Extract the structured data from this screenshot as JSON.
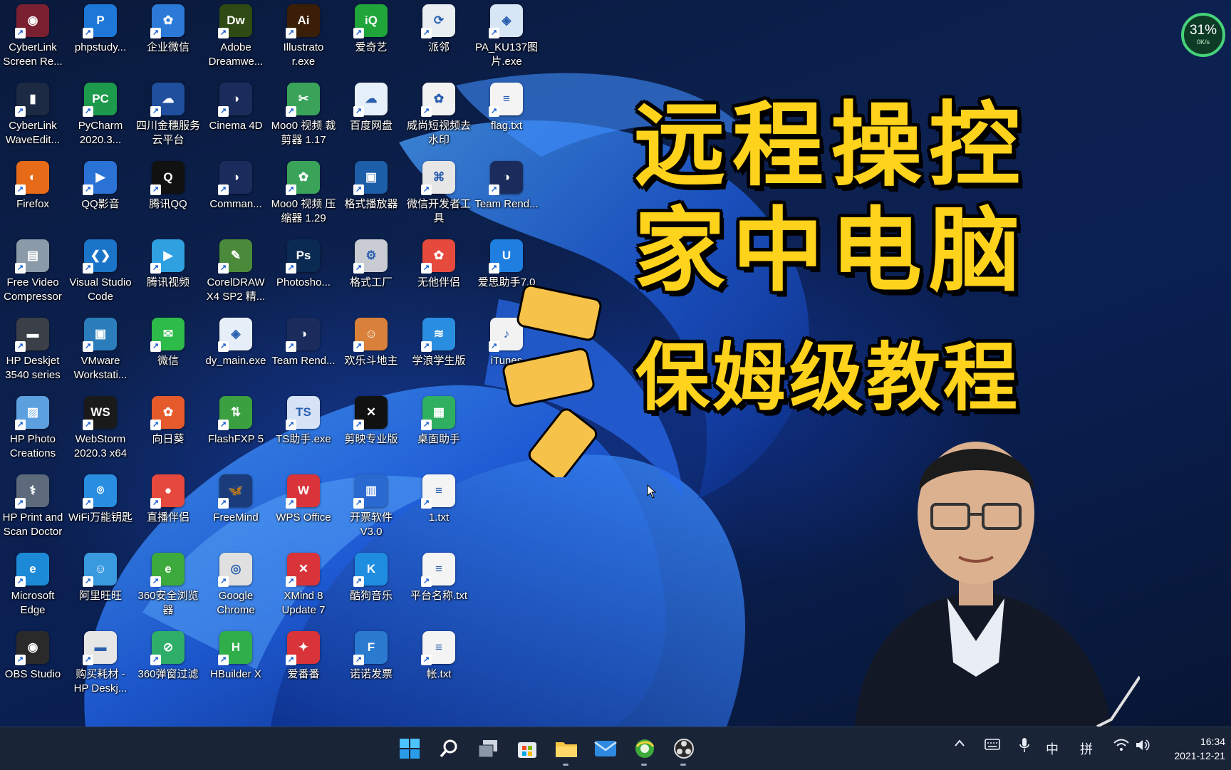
{
  "desktop": {
    "icons": [
      {
        "label": "CyberLink Screen Re...",
        "icon": "cyberlink-screen-recorder-icon",
        "color": "#7a2030",
        "glyph": "◉"
      },
      {
        "label": "phpstudy...",
        "icon": "phpstudy-icon",
        "color": "#1e78d8",
        "glyph": "P"
      },
      {
        "label": "企业微信",
        "icon": "wecom-icon",
        "color": "#2b7ad8",
        "glyph": "✿"
      },
      {
        "label": "Adobe Dreamwe...",
        "icon": "dreamweaver-icon",
        "color": "#2f4a12",
        "glyph": "Dw"
      },
      {
        "label": "Illustrato r.exe",
        "icon": "illustrator-icon",
        "color": "#3a1e06",
        "glyph": "Ai"
      },
      {
        "label": "爱奇艺",
        "icon": "iqiyi-icon",
        "color": "#1fa53a",
        "glyph": "iQ"
      },
      {
        "label": "派邻",
        "icon": "pailin-icon",
        "color": "#e8eef2",
        "glyph": "⟳"
      },
      {
        "label": "PA_KU137图 片.exe",
        "icon": "image-exe-icon",
        "color": "#d6e6f5",
        "glyph": "◈"
      },
      {
        "label": "CyberLink WaveEdit...",
        "icon": "cyberlink-waveeditor-icon",
        "color": "#1c2a44",
        "glyph": "▮"
      },
      {
        "label": "PyCharm 2020.3...",
        "icon": "pycharm-icon",
        "color": "#1d9a4b",
        "glyph": "PC"
      },
      {
        "label": "四川金穗服务 云平台",
        "icon": "sichuan-jinsui-icon",
        "color": "#1f4f9d",
        "glyph": "☁"
      },
      {
        "label": "Cinema 4D",
        "icon": "cinema4d-icon",
        "color": "#1b2c5c",
        "glyph": "◑"
      },
      {
        "label": "Moo0 视频 裁剪器 1.17",
        "icon": "moo0-video-cutter-icon",
        "color": "#3aa35a",
        "glyph": "✂"
      },
      {
        "label": "百度网盘",
        "icon": "baidu-netdisk-icon",
        "color": "#e6f0fb",
        "glyph": "☁"
      },
      {
        "label": "威尚短视频去 水印",
        "icon": "watermark-remover-icon",
        "color": "#f2f2f2",
        "glyph": "✿"
      },
      {
        "label": "flag.txt",
        "icon": "text-file-icon",
        "color": "#f4f4f4",
        "glyph": "≡"
      },
      {
        "label": "Firefox",
        "icon": "firefox-icon",
        "color": "#e66a17",
        "glyph": "◐"
      },
      {
        "label": "QQ影音",
        "icon": "qq-player-icon",
        "color": "#2a72d6",
        "glyph": "▶"
      },
      {
        "label": "腾讯QQ",
        "icon": "tencent-qq-icon",
        "color": "#111111",
        "glyph": "Q"
      },
      {
        "label": "Comman...",
        "icon": "command-app-icon",
        "color": "#1b2c5c",
        "glyph": "◑"
      },
      {
        "label": "Moo0 视频 压缩器 1.29",
        "icon": "moo0-video-compressor-icon",
        "color": "#3aa35a",
        "glyph": "✿"
      },
      {
        "label": "格式播放器",
        "icon": "format-player-icon",
        "color": "#1d5ea8",
        "glyph": "▣"
      },
      {
        "label": "微信开发者工 具",
        "icon": "wechat-devtools-icon",
        "color": "#e6e6e6",
        "glyph": "⌘"
      },
      {
        "label": "Team Rend...",
        "icon": "team-render-icon",
        "color": "#1b2c5c",
        "glyph": "◑"
      },
      {
        "label": "Free Video Compressor",
        "icon": "free-video-compressor-icon",
        "color": "#8b9aa8",
        "glyph": "▤"
      },
      {
        "label": "Visual Studio Code",
        "icon": "vscode-icon",
        "color": "#1a74c8",
        "glyph": "❮❯"
      },
      {
        "label": "腾讯视频",
        "icon": "tencent-video-icon",
        "color": "#2fa0e0",
        "glyph": "▶"
      },
      {
        "label": "CorelDRAW X4 SP2 精...",
        "icon": "coreldraw-icon",
        "color": "#4a8a3a",
        "glyph": "✎"
      },
      {
        "label": "Photosho...",
        "icon": "photoshop-icon",
        "color": "#0b2a52",
        "glyph": "Ps"
      },
      {
        "label": "格式工厂",
        "icon": "format-factory-icon",
        "color": "#c8ccd2",
        "glyph": "⚙"
      },
      {
        "label": "无他伴侣",
        "icon": "wuta-companion-icon",
        "color": "#e54a3c",
        "glyph": "✿"
      },
      {
        "label": "爱思助手7.0",
        "icon": "i4-assistant-icon",
        "color": "#1f7fe0",
        "glyph": "U"
      },
      {
        "label": "HP Deskjet 3540 series",
        "icon": "hp-printer-icon",
        "color": "#3a3f48",
        "glyph": "▬"
      },
      {
        "label": "VMware Workstati...",
        "icon": "vmware-icon",
        "color": "#2b7dbb",
        "glyph": "▣"
      },
      {
        "label": "微信",
        "icon": "wechat-icon",
        "color": "#2dbb4a",
        "glyph": "✉"
      },
      {
        "label": "dy_main.exe",
        "icon": "dy-main-icon",
        "color": "#e6eef8",
        "glyph": "◈"
      },
      {
        "label": "Team Rend...",
        "icon": "team-render-icon",
        "color": "#1b2c5c",
        "glyph": "◑"
      },
      {
        "label": "欢乐斗地主",
        "icon": "doudizhu-game-icon",
        "color": "#d9813a",
        "glyph": "☺"
      },
      {
        "label": "学浪学生版",
        "icon": "xuelang-student-icon",
        "color": "#2a8ee0",
        "glyph": "≋"
      },
      {
        "label": "iTunes",
        "icon": "itunes-icon",
        "color": "#f2f2f2",
        "glyph": "♪"
      },
      {
        "label": "HP Photo Creations",
        "icon": "hp-photo-creations-icon",
        "color": "#5ca0e0",
        "glyph": "▨"
      },
      {
        "label": "WebStorm 2020.3 x64",
        "icon": "webstorm-icon",
        "color": "#1a1a1a",
        "glyph": "WS"
      },
      {
        "label": "向日葵",
        "icon": "sunflower-remote-icon",
        "color": "#e55a2a",
        "glyph": "✿"
      },
      {
        "label": "FlashFXP 5",
        "icon": "flashfxp-icon",
        "color": "#3aa040",
        "glyph": "⇅"
      },
      {
        "label": "TS助手.exe",
        "icon": "ts-helper-icon",
        "color": "#d6e2f5",
        "glyph": "TS"
      },
      {
        "label": "剪映专业版",
        "icon": "jianying-pro-icon",
        "color": "#111111",
        "glyph": "✕"
      },
      {
        "label": "桌面助手",
        "icon": "desktop-helper-icon",
        "color": "#2fb060",
        "glyph": "▦"
      },
      {
        "label": "HP Print and Scan Doctor",
        "icon": "hp-scan-doctor-icon",
        "color": "#5c6a7c",
        "glyph": "⚕"
      },
      {
        "label": "WiFi万能钥匙",
        "icon": "wifi-master-key-icon",
        "color": "#2a8ee0",
        "glyph": "⌾"
      },
      {
        "label": "直播伴侣",
        "icon": "live-companion-icon",
        "color": "#e5483c",
        "glyph": "●"
      },
      {
        "label": "FreeMind",
        "icon": "freemind-icon",
        "color": "#1a3c7a",
        "glyph": "🦋"
      },
      {
        "label": "WPS Office",
        "icon": "wps-office-icon",
        "color": "#d8343a",
        "glyph": "W"
      },
      {
        "label": "开票软件 V3.0",
        "icon": "invoice-software-icon",
        "color": "#2a6ad0",
        "glyph": "▥"
      },
      {
        "label": "1.txt",
        "icon": "text-file-icon",
        "color": "#f4f4f4",
        "glyph": "≡"
      },
      {
        "label": "Microsoft Edge",
        "icon": "edge-icon",
        "color": "#1c8ad6",
        "glyph": "e"
      },
      {
        "label": "阿里旺旺",
        "icon": "aliwangwang-icon",
        "color": "#3a9ae0",
        "glyph": "☺"
      },
      {
        "label": "360安全浏览 器",
        "icon": "360-browser-icon",
        "color": "#3caa3c",
        "glyph": "e"
      },
      {
        "label": "Google Chrome",
        "icon": "chrome-icon",
        "color": "#e0e0e0",
        "glyph": "◎"
      },
      {
        "label": "XMind 8 Update 7",
        "icon": "xmind-icon",
        "color": "#d8343a",
        "glyph": "✕"
      },
      {
        "label": "酷狗音乐",
        "icon": "kugou-music-icon",
        "color": "#1f8ee0",
        "glyph": "K"
      },
      {
        "label": "平台名称.txt",
        "icon": "text-file-icon",
        "color": "#f4f4f4",
        "glyph": "≡"
      },
      {
        "label": "OBS Studio",
        "icon": "obs-studio-icon",
        "color": "#2a2a2a",
        "glyph": "◉"
      },
      {
        "label": "购买耗材 - HP Deskj...",
        "icon": "hp-supplies-icon",
        "color": "#e6e6e6",
        "glyph": "▬"
      },
      {
        "label": "360弹窗过滤",
        "icon": "360-popup-filter-icon",
        "color": "#2fae6a",
        "glyph": "⊘"
      },
      {
        "label": "HBuilder X",
        "icon": "hbuilder-icon",
        "color": "#2fae4a",
        "glyph": "H"
      },
      {
        "label": "爱番番",
        "icon": "aifanfan-icon",
        "color": "#d8343a",
        "glyph": "✦"
      },
      {
        "label": "诺诺发票",
        "icon": "nuonuo-invoice-icon",
        "color": "#2a7ad0",
        "glyph": "F"
      },
      {
        "label": "帐.txt",
        "icon": "text-file-icon",
        "color": "#f4f4f4",
        "glyph": "≡"
      }
    ]
  },
  "overlay": {
    "line1": "远程操控",
    "line2": "家中电脑",
    "line3": "保姆级教程",
    "accent_color": "#ffd21c",
    "burst_color": "#f7c24a"
  },
  "net_meter": {
    "percent": "31%",
    "speed": "0K/s"
  },
  "taskbar": {
    "apps": [
      {
        "name": "start-button",
        "icon": "windows-start-icon"
      },
      {
        "name": "search-button",
        "icon": "search-icon"
      },
      {
        "name": "task-view-button",
        "icon": "task-view-icon"
      },
      {
        "name": "store-button",
        "icon": "microsoft-store-icon"
      },
      {
        "name": "file-explorer-button",
        "icon": "folder-icon"
      },
      {
        "name": "mail-button",
        "icon": "mail-icon"
      },
      {
        "name": "browser-button",
        "icon": "360-browser-icon"
      },
      {
        "name": "obs-button",
        "icon": "obs-studio-icon"
      }
    ],
    "tray": {
      "ime_lang": "中",
      "ime_mode": "拼"
    },
    "clock": {
      "time": "16:34",
      "date": "2021-12-21"
    }
  }
}
